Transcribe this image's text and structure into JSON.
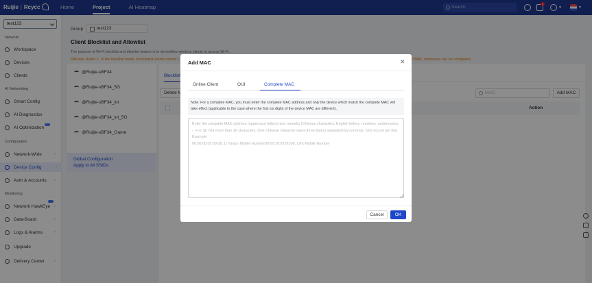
{
  "app": {
    "logo_brand": "Ruijie",
    "logo_sub": "Rcycc",
    "nav": [
      {
        "label": "Home"
      },
      {
        "label": "Project"
      },
      {
        "label": "AI Heatmap"
      }
    ],
    "search_placeholder": "Search",
    "notification_count": "1"
  },
  "sidebar": {
    "site_value": "test123",
    "sections": {
      "network": "Network",
      "ai_networking": "AI Networking",
      "configuration": "Configuration",
      "monitoring": "Monitoring"
    },
    "items": {
      "workspace": "Workspace",
      "devices": "Devices",
      "clients": "Clients",
      "smart_config": "Smart Config",
      "ai_diagnostics": "AI Diagnostics",
      "ai_optimization": "AI Optimization",
      "network_wide": "Network-Wide",
      "device_config": "Device Config",
      "auth_accounts": "Auth & Accounts",
      "network_hawkeye": "Network HawkEye",
      "data_board": "Data-Board",
      "logs_alarms": "Logs & Alarms",
      "upgrade": "Upgrade",
      "delivery_center": "Delivery Center"
    }
  },
  "page": {
    "group_label": "Group",
    "group_value": "test123",
    "title": "Client Blocklist and Allowlist",
    "description": "The purpose of Wi-Fi blocklist and allowlist feature is to deny/allow wireless clients to access Wi-Fi.",
    "warning": "Effective Rules: 1. In the blocklist mode, blocklisted clients cannot c",
    "warning_right": "2 MAC addresses can be configured.",
    "ssids": [
      "@Ruijie-sBF34",
      "@Ruijie-sBF34_5G",
      "@Ruijie-sBF34_iot",
      "@Ruijie-sBF34_iot_5G",
      "@Ruijie-sBF34_Game"
    ],
    "global_config_line1": "Global Configuration",
    "global_config_line2": "Apply to All SSIDs",
    "tab_blocklist": "Blocklist",
    "delete_button": "Delete M",
    "mac_search_placeholder": "MAC",
    "add_mac_button": "Add MAC",
    "table_action_header": "Action"
  },
  "modal": {
    "title": "Add MAC",
    "tabs": [
      "Online Client",
      "OUI",
      "Complete MAC"
    ],
    "active_tab": "Complete MAC",
    "note": "Note: For a complete MAC, you must enter the complete MAC address and only the device which match the complete MAC will take effect (applicable to the case where the first six digits of the device MAC are different).",
    "textarea_placeholder": "Enter the complete MAC address (uppercase letters) and remarks (Chinese characters, English letters, numbers, underscores, -, # or @. Not more than 16 characters. One Chinese character takes three bytes) separated by commas. One record per line. Example:\n00:00:00:02:00:08, Li Yang's Mobile Number00:00:10:02:00:08, Lili's Mobile Number",
    "cancel_label": "Cancel",
    "ok_label": "OK"
  },
  "colors": {
    "topbar": "#1f3a93",
    "accent": "#1f48c9",
    "warning": "#e6750a"
  }
}
